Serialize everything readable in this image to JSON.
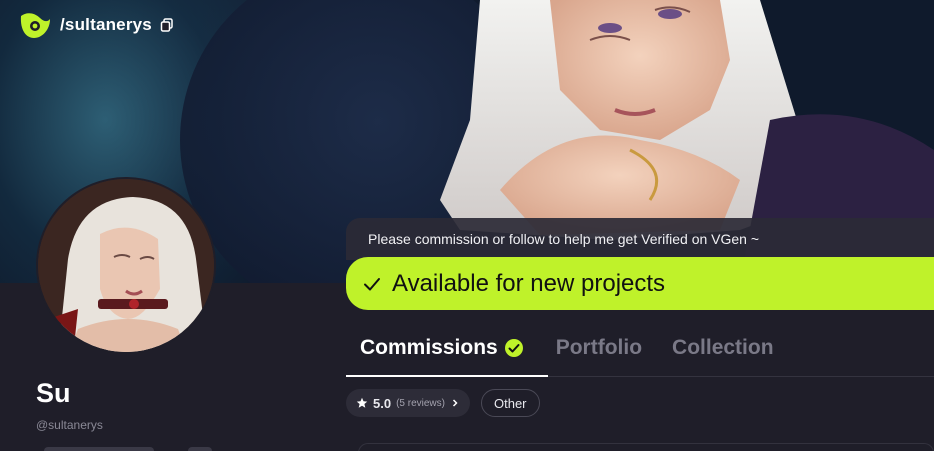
{
  "header": {
    "handle": "/sultanerys"
  },
  "banner": {
    "notice": "Please commission or follow to help me get Verified on VGen ~",
    "availability": "Available for new projects"
  },
  "profile": {
    "name": "Su",
    "username": "@sultanerys"
  },
  "tabs": [
    {
      "label": "Commissions",
      "active": true
    },
    {
      "label": "Portfolio",
      "active": false
    },
    {
      "label": "Collection",
      "active": false
    }
  ],
  "filters": {
    "rating": "5.0",
    "reviews": "(5 reviews)",
    "other": "Other"
  },
  "colors": {
    "accent": "#bff22a",
    "background": "#1f1e29",
    "chip": "#2d2c38"
  },
  "icons": {
    "logo": "vgen-logo-icon",
    "copy": "copy-icon",
    "check": "check-icon",
    "verified": "verified-icon",
    "star": "star-icon",
    "chevron": "chevron-right-icon"
  }
}
